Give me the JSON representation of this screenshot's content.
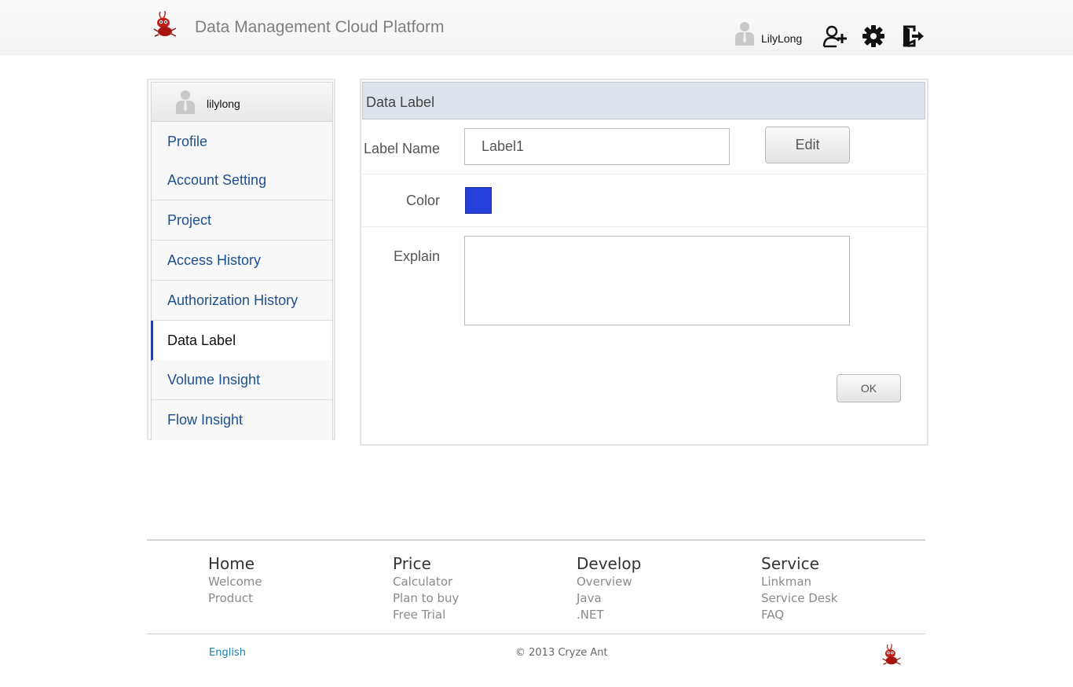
{
  "header": {
    "title": "Data Management Cloud Platform",
    "user_name": "LilyLong",
    "icons": [
      "add-user-icon",
      "gear-icon",
      "logout-icon"
    ]
  },
  "sidebar": {
    "user": "lilylong",
    "items": [
      {
        "label": "Profile"
      },
      {
        "label": "Account Setting"
      },
      {
        "label": "Project"
      },
      {
        "label": "Access History"
      },
      {
        "label": "Authorization History"
      },
      {
        "label": "Data Label",
        "active": true
      },
      {
        "label": "Volume Insight"
      },
      {
        "label": "Flow Insight"
      }
    ]
  },
  "panel": {
    "title": "Data Label",
    "label_name_label": "Label Name",
    "label_name_value": "Label1",
    "edit_button": "Edit",
    "color_label": "Color",
    "color_value": "#2540d9",
    "explain_label": "Explain",
    "explain_value": "",
    "ok_button": "OK"
  },
  "footer": {
    "columns": [
      {
        "heading": "Home",
        "links": [
          "Welcome",
          "Product"
        ]
      },
      {
        "heading": "Price",
        "links": [
          "Calculator",
          "Plan to buy",
          "Free Trial"
        ]
      },
      {
        "heading": "Develop",
        "links": [
          "Overview",
          "Java",
          ".NET"
        ]
      },
      {
        "heading": "Service",
        "links": [
          "Linkman",
          "Service Desk",
          "FAQ"
        ]
      }
    ],
    "language": "English",
    "copyright": "© 2013 Cryze Ant"
  },
  "colors": {
    "link": "#1f4f8f",
    "active_marker": "#2b3fa8",
    "panel_header": "#dce3ea",
    "logo_red": "#c0201a"
  }
}
